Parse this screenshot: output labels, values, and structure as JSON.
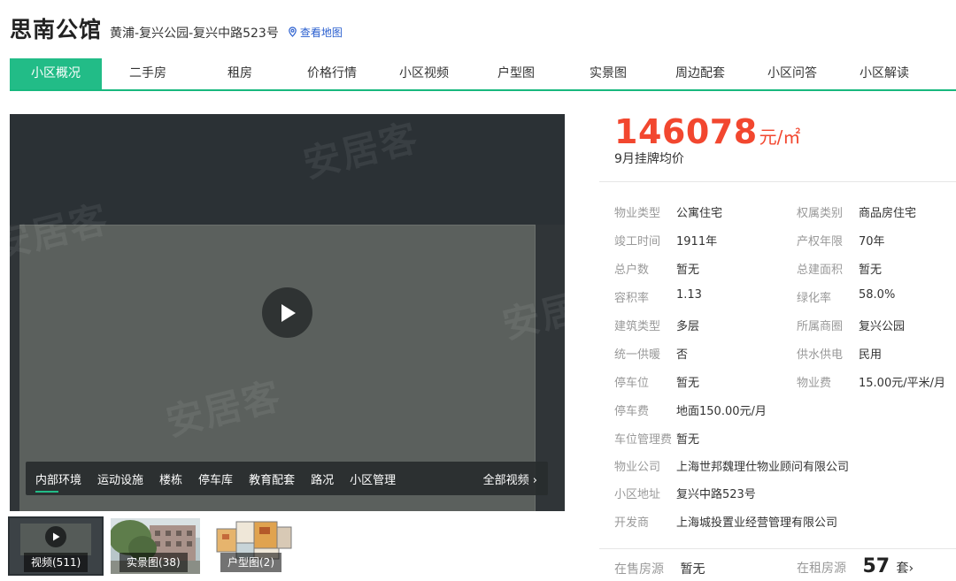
{
  "header": {
    "title": "思南公馆",
    "address": "黄浦-复兴公园-复兴中路523号",
    "map_link": "查看地图"
  },
  "nav": {
    "tabs": [
      "小区概况",
      "二手房",
      "租房",
      "价格行情",
      "小区视频",
      "户型图",
      "实景图",
      "周边配套",
      "小区问答",
      "小区解读"
    ],
    "active_index": 0
  },
  "video": {
    "watermark": "安居客",
    "tabs": [
      "内部环境",
      "运动设施",
      "楼栋",
      "停车库",
      "教育配套",
      "路况",
      "小区管理"
    ],
    "active_tab": 0,
    "all_videos": "全部视频 ›"
  },
  "thumbnails": [
    {
      "label": "视频(511)",
      "type": "video"
    },
    {
      "label": "实景图(38)",
      "type": "photo"
    },
    {
      "label": "户型图(2)",
      "type": "floorplan"
    }
  ],
  "price": {
    "value": "146078",
    "unit": "元/㎡",
    "label": "9月挂牌均价"
  },
  "info": {
    "rows": [
      {
        "l1": "物业类型",
        "v1": "公寓住宅",
        "l2": "权属类别",
        "v2": "商品房住宅"
      },
      {
        "l1": "竣工时间",
        "v1": "1911年",
        "l2": "产权年限",
        "v2": "70年"
      },
      {
        "l1": "总户数",
        "v1": "暂无",
        "l2": "总建面积",
        "v2": "暂无"
      },
      {
        "l1": "容积率",
        "v1": "1.13",
        "l2": "绿化率",
        "v2": "58.0%"
      },
      {
        "l1": "建筑类型",
        "v1": "多层",
        "l2": "所属商圈",
        "v2": "复兴公园"
      },
      {
        "l1": "统一供暖",
        "v1": "否",
        "l2": "供水供电",
        "v2": "民用"
      },
      {
        "l1": "停车位",
        "v1": "暂无",
        "l2": "物业费",
        "v2": "15.00元/平米/月"
      },
      {
        "l1": "停车费",
        "v1": "地面150.00元/月"
      },
      {
        "l1": "车位管理费",
        "v1": "暂无"
      },
      {
        "l1": "物业公司",
        "v1": "上海世邦魏理仕物业顾问有限公司"
      },
      {
        "l1": "小区地址",
        "v1": "复兴中路523号"
      },
      {
        "l1": "开发商",
        "v1": "上海城投置业经营管理有限公司"
      }
    ]
  },
  "listings": {
    "sale_label": "在售房源",
    "sale_value": "暂无",
    "rent_label": "在租房源",
    "rent_value": "57",
    "rent_suffix": "套›"
  },
  "colors": {
    "accent_green": "#22bc87",
    "price_red": "#f2472f",
    "link_blue": "#2a5fcf"
  }
}
